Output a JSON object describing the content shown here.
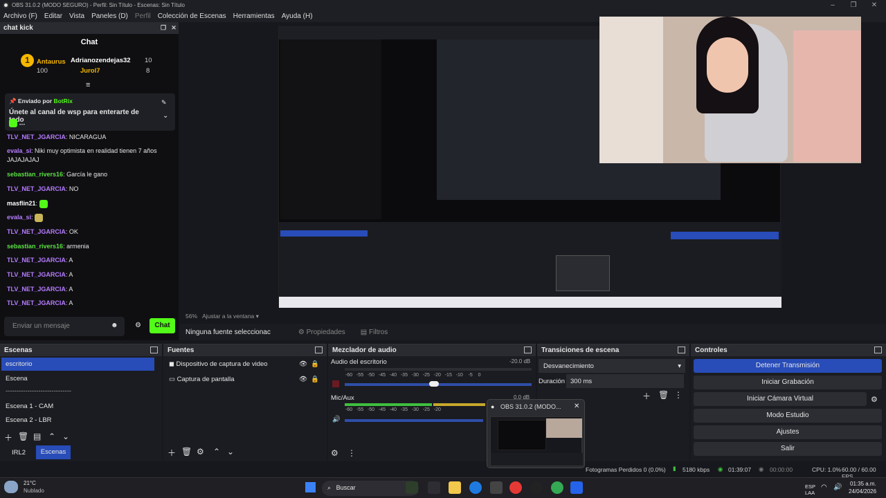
{
  "window": {
    "title": "OBS 31.0.2 (MODO SEGURO) - Perfil: Sin Título - Escenas: Sin Título"
  },
  "menu": [
    "Archivo (F)",
    "Editar",
    "Vista",
    "Paneles (D)",
    "Perfil",
    "Colección de Escenas",
    "Herramientas",
    "Ayuda (H)"
  ],
  "chat": {
    "dock_title": "chat kick",
    "title": "Chat",
    "leaders": [
      {
        "name": "Antaurus",
        "value": "100"
      },
      {
        "name": "Adrianozendejas32",
        "value": "10"
      },
      {
        "name": "Jurol7",
        "value": "8"
      }
    ],
    "pinned": {
      "sent_by": "Enviado por",
      "bot": "BotRix",
      "text": "Únete al canal de wsp para enterarte de todo",
      "suffix": "..."
    },
    "messages": [
      {
        "user": "TLV_NET_JGARCIA",
        "text": ": NICARAGUA",
        "color": "purple"
      },
      {
        "user": "evala_si",
        "text": ": Niki muy optimista en realidad tienen 7 años JAJAJAJAJ",
        "color": "purple"
      },
      {
        "user": "sebastian_rivers16",
        "text": ": García le gano",
        "color": "green"
      },
      {
        "user": "TLV_NET_JGARCIA",
        "text": ": NO",
        "color": "purple"
      },
      {
        "user": "masflin21",
        "text": ":",
        "color": "white"
      },
      {
        "user": "evala_si",
        "text": ":",
        "color": "purple"
      },
      {
        "user": "TLV_NET_JGARCIA",
        "text": ": OK",
        "color": "purple"
      },
      {
        "user": "sebastian_rivers16",
        "text": ": armenia",
        "color": "green"
      },
      {
        "user": "TLV_NET_JGARCIA",
        "text": ": A",
        "color": "purple"
      },
      {
        "user": "TLV_NET_JGARCIA",
        "text": ": A",
        "color": "purple"
      },
      {
        "user": "TLV_NET_JGARCIA",
        "text": ": A",
        "color": "purple"
      },
      {
        "user": "TLV_NET_JGARCIA",
        "text": ": A",
        "color": "purple"
      }
    ],
    "input_placeholder": "Enviar un mensaje",
    "send": "Chat"
  },
  "preview": {
    "zoom": "56%",
    "fit": "Ajustar a la ventana"
  },
  "source_bar": {
    "none": "Ninguna fuente seleccionac",
    "props": "Propiedades",
    "filters": "Filtros"
  },
  "scenes": {
    "title": "Escenas",
    "items": [
      "escritorio",
      "Escena",
      "------------------------------",
      "Escena 1 - CAM",
      "Escena 2 - LBR"
    ],
    "tabs": [
      "IRL2",
      "Escenas"
    ]
  },
  "sources": {
    "title": "Fuentes",
    "items": [
      "Dispositivo de captura de video",
      "Captura de pantalla"
    ]
  },
  "mixer": {
    "title": "Mezclador de audio",
    "channels": [
      {
        "name": "Audio del escritorio",
        "db": "-20.0 dB"
      },
      {
        "name": "Mic/Aux",
        "db": "0.0 dB"
      }
    ],
    "ticks": [
      "-60",
      "-55",
      "-50",
      "-45",
      "-40",
      "-35",
      "-30",
      "-25",
      "-20",
      "-15",
      "-10",
      "-5",
      "0"
    ]
  },
  "transitions": {
    "title": "Transiciones de escena",
    "selected": "Desvanecimiento",
    "duration_label": "Duración",
    "duration": "300 ms"
  },
  "controls": {
    "title": "Controles",
    "buttons": [
      "Detener Transmisión",
      "Iniciar Grabación",
      "Iniciar Cámara Virtual",
      "Modo Estudio",
      "Ajustes",
      "Salir"
    ]
  },
  "popup": {
    "title": "OBS 31.0.2 (MODO..."
  },
  "status": {
    "dropped": "Fotogramas Perdidos 0 (0.0%)",
    "bitrate": "5180 kbps",
    "time": "01:39:07",
    "rec": "00:00:00",
    "cpu": "CPU: 1.0%",
    "fps": "60.00 / 60.00 FPS"
  },
  "taskbar": {
    "temp": "21°C",
    "weather": "Nublado",
    "search": "Buscar",
    "lang": "ESP",
    "layout": "LAA",
    "clock": "01:35 a.m.",
    "date": "24/04/2026"
  },
  "colors": {
    "accent": "#284cb8",
    "kick_green": "#53fc18"
  }
}
